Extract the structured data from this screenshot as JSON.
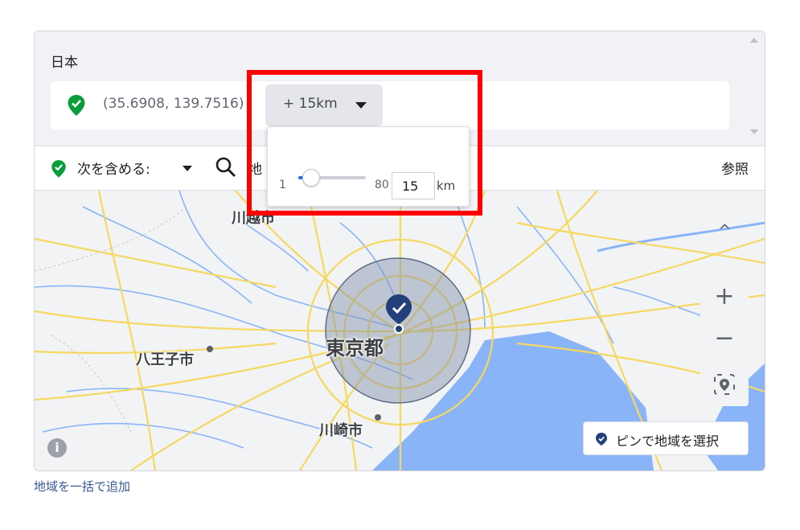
{
  "location": {
    "country": "日本",
    "coords": "(35.6908, 139.7516)",
    "radius_label": "+ 15km"
  },
  "toolbar": {
    "include_label": "次を含める:",
    "search_placeholder": "地",
    "browse_label": "参照"
  },
  "map": {
    "labels": {
      "kawagoe": "川越市",
      "tokyo": "東京都",
      "hachioji": "八王子市",
      "kawasaki": "川崎市"
    },
    "pin_select_label": "ピンで地域を選択",
    "info_symbol": "i",
    "zoom_in": "+",
    "zoom_out": "−",
    "chevron": "^"
  },
  "radius_popup": {
    "min": "1",
    "max": "80",
    "value": "15",
    "unit": "km",
    "slider_fraction": 0.177
  },
  "bulk_add_link": "地域を一括で追加",
  "colors": {
    "green": "#1db954",
    "accent": "#1877f2",
    "pin": "#23407a",
    "highlight": "#ff0000"
  }
}
